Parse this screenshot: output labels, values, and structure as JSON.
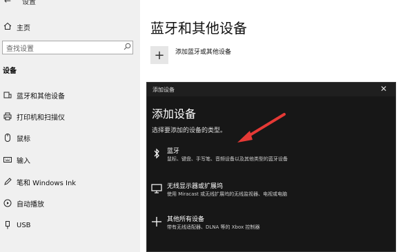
{
  "window": {
    "title": "设置"
  },
  "sidebar": {
    "home_label": "主页",
    "search_placeholder": "查找设置",
    "section_title": "设备",
    "items": [
      {
        "label": "蓝牙和其他设备",
        "icon": "bluetooth-devices-icon"
      },
      {
        "label": "打印机和扫描仪",
        "icon": "printer-icon"
      },
      {
        "label": "鼠标",
        "icon": "mouse-icon"
      },
      {
        "label": "输入",
        "icon": "keyboard-icon"
      },
      {
        "label": "笔和 Windows Ink",
        "icon": "pen-icon"
      },
      {
        "label": "自动播放",
        "icon": "autoplay-icon"
      },
      {
        "label": "USB",
        "icon": "usb-icon"
      }
    ]
  },
  "main": {
    "title": "蓝牙和其他设备",
    "add_device_label": "添加蓝牙或其他设备"
  },
  "dialog": {
    "title": "添加设备",
    "heading": "添加设备",
    "subtitle": "选择要添加的设备的类型。",
    "options": [
      {
        "title": "蓝牙",
        "desc": "鼠标、键盘、手写笔、音频设备以及其他类型的蓝牙设备",
        "icon": "bluetooth-icon"
      },
      {
        "title": "无线显示器或扩展坞",
        "desc": "使用 Miracast 或无线扩展坞的无线监视器、电视或电脑",
        "icon": "monitor-icon"
      },
      {
        "title": "其他所有设备",
        "desc": "带有无线适配器、DLNA 等的 Xbox 控制器",
        "icon": "plus-icon"
      }
    ]
  },
  "colors": {
    "annotation_arrow": "#e53935",
    "dialog_bg": "#171717",
    "sidebar_bg": "#f0f0f0"
  }
}
